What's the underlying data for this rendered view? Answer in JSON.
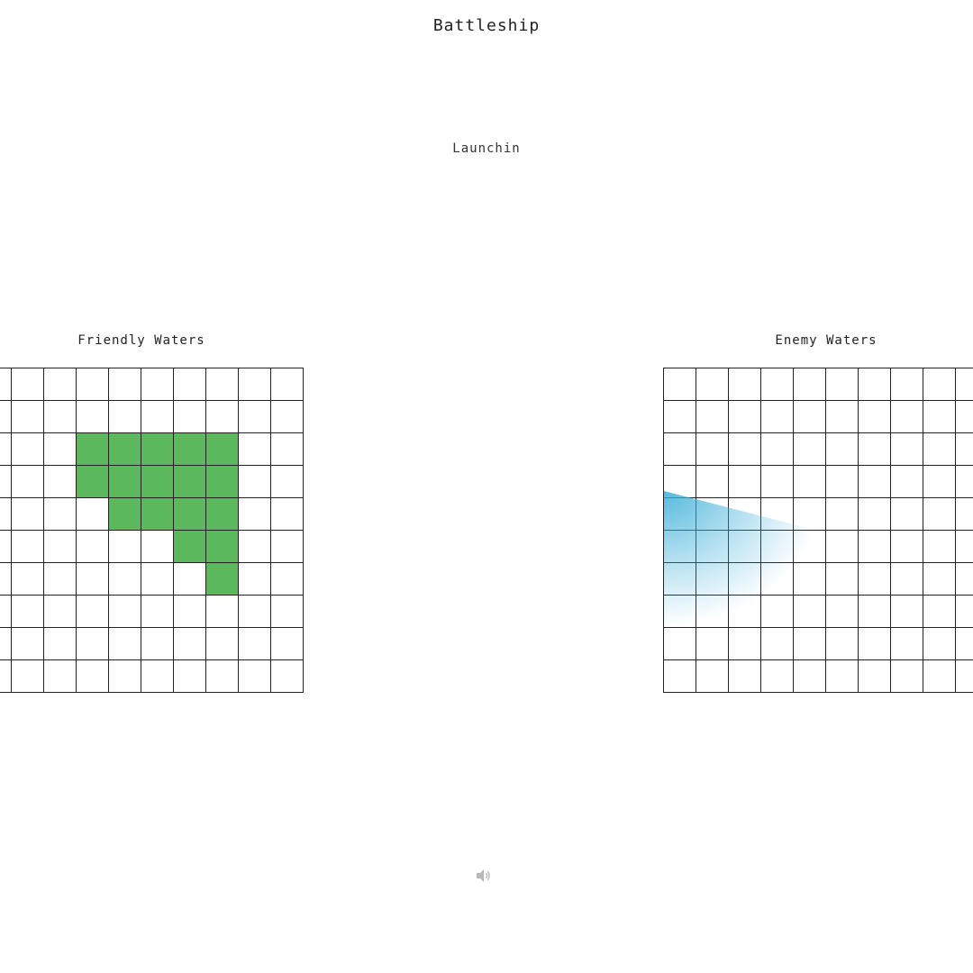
{
  "game": {
    "title": "Battleship",
    "status": "Launchin"
  },
  "friendly": {
    "label": "Friendly Waters",
    "ship_color": "#5cb85c",
    "ship_cells": [
      [
        2,
        3
      ],
      [
        2,
        4
      ],
      [
        2,
        5
      ],
      [
        2,
        6
      ],
      [
        2,
        7
      ],
      [
        3,
        3
      ],
      [
        3,
        4
      ],
      [
        3,
        5
      ],
      [
        3,
        6
      ],
      [
        3,
        7
      ],
      [
        4,
        4
      ],
      [
        4,
        5
      ],
      [
        4,
        6
      ],
      [
        4,
        7
      ],
      [
        5,
        6
      ],
      [
        5,
        7
      ],
      [
        6,
        7
      ]
    ]
  },
  "enemy": {
    "label": "Enemy Waters",
    "radar_color": "#3aaed8"
  },
  "controls": {
    "sound_icon": "speaker-icon"
  }
}
